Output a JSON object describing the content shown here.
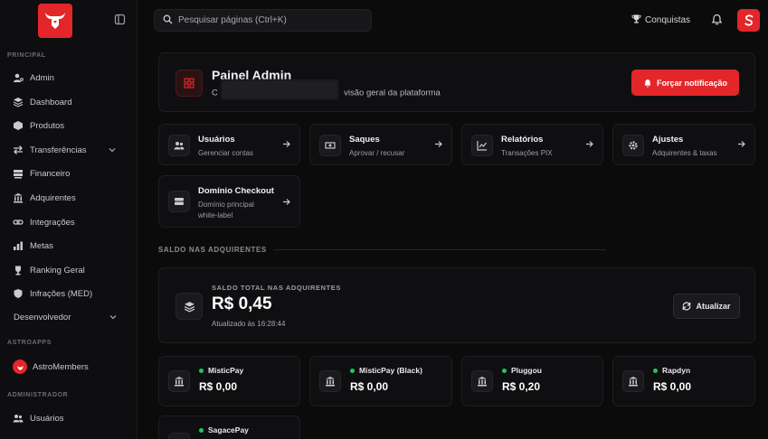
{
  "colors": {
    "accent": "#e3262a",
    "online": "#22c55e",
    "background": "#0b0b0c"
  },
  "sidebar": {
    "sections": {
      "principal": "PRINCIPAL",
      "astroapps": "ASTROAPPS",
      "administrador": "ADMINISTRADOR"
    },
    "items": [
      {
        "label": "Admin",
        "icon": "user-gear-icon"
      },
      {
        "label": "Dashboard",
        "icon": "layers-icon"
      },
      {
        "label": "Produtos",
        "icon": "box-icon"
      },
      {
        "label": "Transferências",
        "icon": "transfer-icon"
      },
      {
        "label": "Financeiro",
        "icon": "money-icon"
      },
      {
        "label": "Adquirentes",
        "icon": "bank-icon"
      },
      {
        "label": "Integrações",
        "icon": "link-icon"
      },
      {
        "label": "Metas",
        "icon": "chart-icon"
      },
      {
        "label": "Ranking Geral",
        "icon": "trophy-icon"
      },
      {
        "label": "Infrações (MED)",
        "icon": "shield-icon"
      }
    ],
    "developer": "Desenvolvedor",
    "astromembers": "AstroMembers",
    "users": "Usuários"
  },
  "topbar": {
    "search_placeholder": "Pesquisar páginas (Ctrl+K)",
    "achievements": "Conquistas"
  },
  "hero": {
    "title": "Painel Admin",
    "subtitle_start": "C",
    "subtitle_end": "visão geral da plataforma",
    "force_button": "Forçar notificação"
  },
  "cards": [
    {
      "title": "Usuários",
      "sub": "Gerenciar contas",
      "icon": "users-icon"
    },
    {
      "title": "Saques",
      "sub": "Aprovar / recusar",
      "icon": "cash-icon"
    },
    {
      "title": "Relatórios",
      "sub": "Transações PIX",
      "icon": "chart-line-icon"
    },
    {
      "title": "Ajustes",
      "sub": "Adquirentes & taxas",
      "icon": "gear-icon"
    },
    {
      "title": "Domínio Checkout",
      "sub": "Domínio principal white-label",
      "icon": "server-icon"
    }
  ],
  "balances": {
    "section_title": "SALDO NAS ADQUIRENTES",
    "total_label": "SALDO TOTAL NAS ADQUIRENTES",
    "total_value": "R$ 0,45",
    "updated": "Atualizado às 16:28:44",
    "refresh_button": "Atualizar",
    "acquirers": [
      {
        "name": "MisticPay",
        "value": "R$ 0,00"
      },
      {
        "name": "MisticPay (Black)",
        "value": "R$ 0,00"
      },
      {
        "name": "Pluggou",
        "value": "R$ 0,20"
      },
      {
        "name": "Rapdyn",
        "value": "R$ 0,00"
      },
      {
        "name": "SagacePay",
        "value": ""
      }
    ]
  }
}
